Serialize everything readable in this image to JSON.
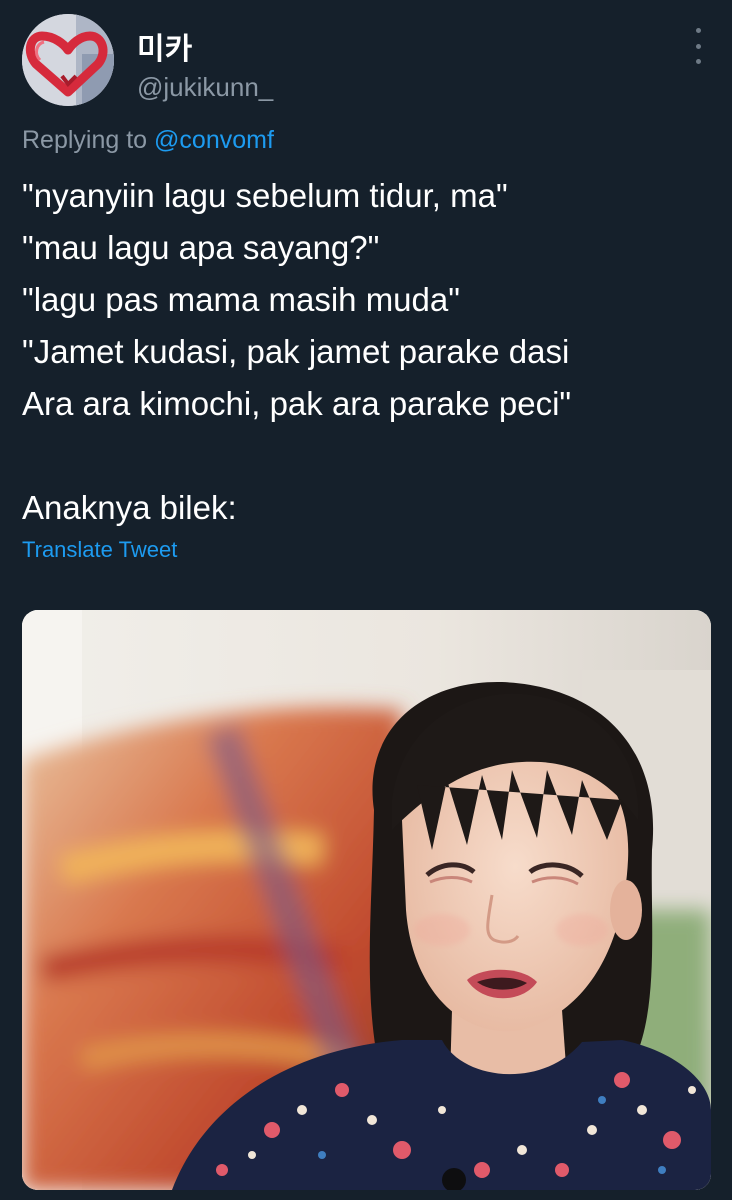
{
  "tweet": {
    "display_name": "미카",
    "handle": "@jukikunn_",
    "avatar_icon": "heart-hands-avatar",
    "more_icon": "more-vertical-icon",
    "reply": {
      "prefix": "Replying to",
      "mention": "@convomf"
    },
    "lines": [
      "\"nyanyiin lagu sebelum tidur, ma\"",
      "\"mau lagu apa sayang?\"",
      "\"lagu pas mama masih muda\"",
      "\"Jamet kudasi, pak jamet parake dasi",
      "Ara ara kimochi, pak ara parake peci\"",
      "",
      "Anaknya bilek:"
    ],
    "translate_label": "Translate Tweet"
  },
  "colors": {
    "background": "#15202b",
    "text": "#ffffff",
    "secondary": "#8b98a5",
    "link": "#1d9bf0"
  }
}
